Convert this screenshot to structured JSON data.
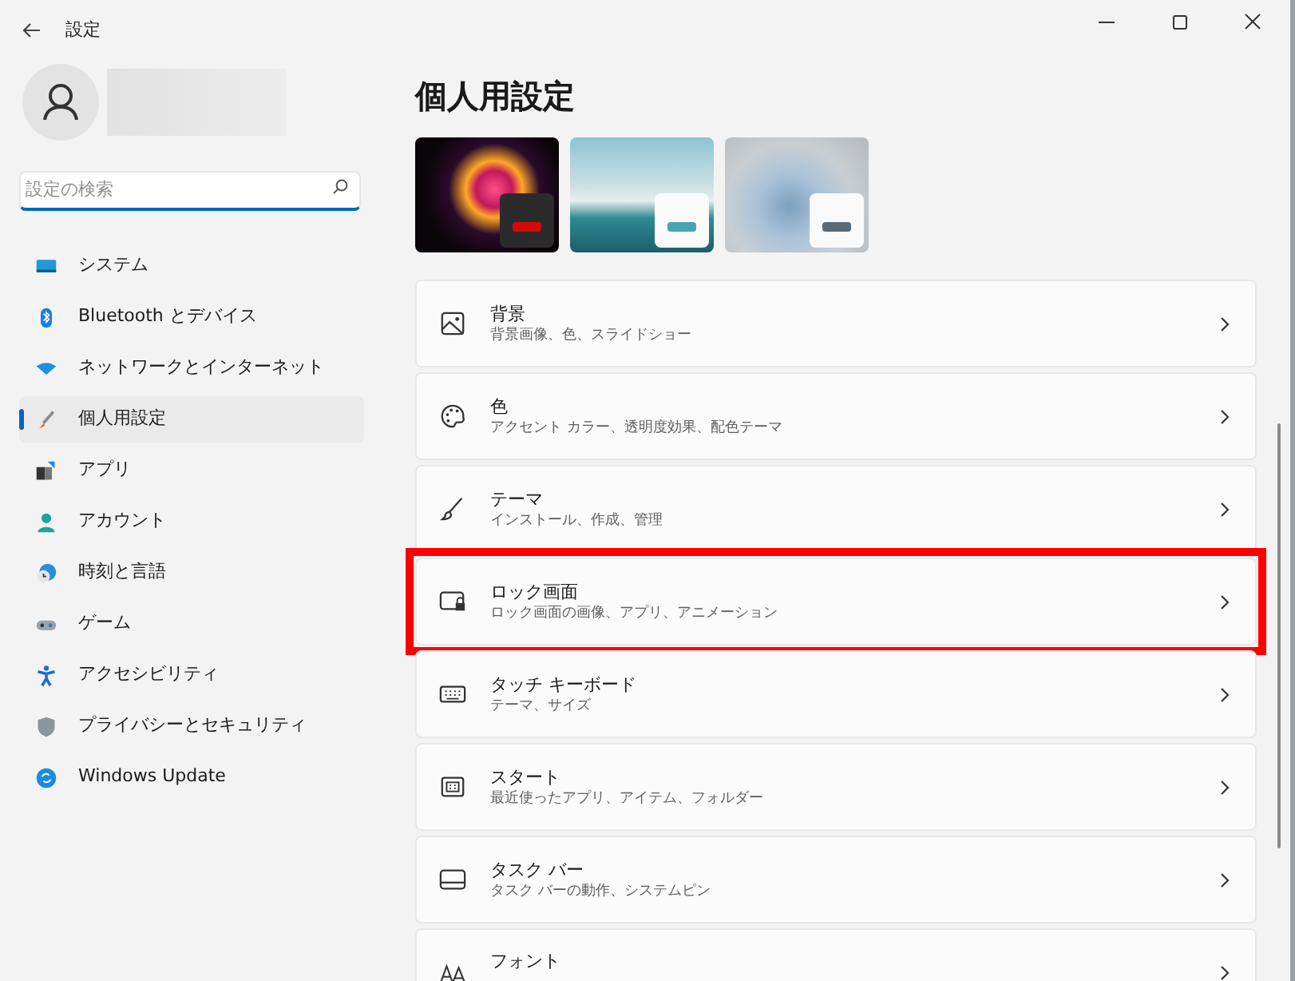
{
  "window": {
    "title": "設定"
  },
  "search": {
    "placeholder": "設定の検索"
  },
  "sidebar": {
    "items": [
      {
        "label": "システム",
        "selected": false
      },
      {
        "label": "Bluetooth とデバイス",
        "selected": false
      },
      {
        "label": "ネットワークとインターネット",
        "selected": false
      },
      {
        "label": "個人用設定",
        "selected": true
      },
      {
        "label": "アプリ",
        "selected": false
      },
      {
        "label": "アカウント",
        "selected": false
      },
      {
        "label": "時刻と言語",
        "selected": false
      },
      {
        "label": "ゲーム",
        "selected": false
      },
      {
        "label": "アクセシビリティ",
        "selected": false
      },
      {
        "label": "プライバシーとセキュリティ",
        "selected": false
      },
      {
        "label": "Windows Update",
        "selected": false
      }
    ]
  },
  "page_title": "個人用設定",
  "themes": [
    {
      "kind": "dark",
      "color": "#d10a0a"
    },
    {
      "kind": "light",
      "color": "#4aa3b5"
    },
    {
      "kind": "light",
      "color": "#5a6b78"
    }
  ],
  "settings": [
    {
      "title": "背景",
      "subtitle": "背景画像、色、スライドショー",
      "highlighted": false
    },
    {
      "title": "色",
      "subtitle": "アクセント カラー、透明度効果、配色テーマ",
      "highlighted": false
    },
    {
      "title": "テーマ",
      "subtitle": "インストール、作成、管理",
      "highlighted": false
    },
    {
      "title": "ロック画面",
      "subtitle": "ロック画面の画像、アプリ、アニメーション",
      "highlighted": true
    },
    {
      "title": "タッチ キーボード",
      "subtitle": "テーマ、サイズ",
      "highlighted": false
    },
    {
      "title": "スタート",
      "subtitle": "最近使ったアプリ、アイテム、フォルダー",
      "highlighted": false
    },
    {
      "title": "タスク バー",
      "subtitle": "タスク バーの動作、システムピン",
      "highlighted": false
    },
    {
      "title": "フォント",
      "highlighted": false
    }
  ]
}
